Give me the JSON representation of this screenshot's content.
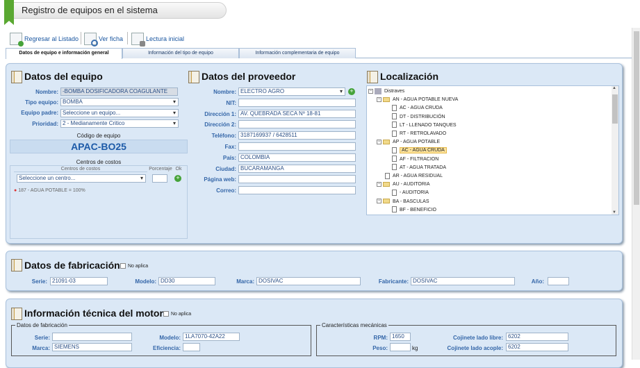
{
  "header": {
    "title": "Registro de equipos en el sistema"
  },
  "toolbar": {
    "back": "Regresar al Listado",
    "view": "Ver ficha",
    "reading": "Lectura inicial"
  },
  "tabs": [
    "Datos de equipo e información general",
    "Información del tipo de equipo",
    "Información complementaria de equipo"
  ],
  "equipo": {
    "title": "Datos del equipo",
    "nombre_label": "Nombre:",
    "nombre": "-BOMBA DOSIFICADORA COAGULANTE",
    "tipo_label": "Tipo equipo:",
    "tipo": "BOMBA",
    "padre_label": "Equipo padre:",
    "padre": "Seleccione un equipo...",
    "prioridad_label": "Prioridad:",
    "prioridad": "2 - Medianamente Critico",
    "codigo_label": "Código de equipo",
    "codigo": "APAC-BO25",
    "centros_title": "Centros de costos",
    "centros_col": "Centros de costos",
    "porcentaje_col": "Porcentaje",
    "ok_col": "Ok",
    "centro_select": "Seleccione un centro...",
    "centro_item": "187 - AGUA POTABLE = 100%"
  },
  "proveedor": {
    "title": "Datos del proveedor",
    "fields": [
      {
        "label": "Nombre:",
        "value": "ELECTRO AGRO"
      },
      {
        "label": "NIT:",
        "value": ""
      },
      {
        "label": "Dirección 1:",
        "value": "AV. QUEBRADA SECA Nº 18-81"
      },
      {
        "label": "Dirección 2:",
        "value": ""
      },
      {
        "label": "Teléfono:",
        "value": "3187169937 / 6428511"
      },
      {
        "label": "Fax:",
        "value": ""
      },
      {
        "label": "País:",
        "value": "COLOMBIA"
      },
      {
        "label": "Ciudad:",
        "value": "BUCARAMANGA"
      },
      {
        "label": "Página web:",
        "value": ""
      },
      {
        "label": "Correo:",
        "value": ""
      }
    ]
  },
  "localizacion": {
    "title": "Localización",
    "tree": [
      {
        "text": "Distraves",
        "type": "root"
      },
      {
        "text": "AN - AGUA POTABLE NUEVA",
        "type": "folder"
      },
      {
        "text": "AC - AGUA CRUDA",
        "type": "doc"
      },
      {
        "text": "DT - DISTRIBUCIÓN",
        "type": "doc"
      },
      {
        "text": "LT - LLENADO TANQUES",
        "type": "doc"
      },
      {
        "text": "RT - RETROLAVADO",
        "type": "doc"
      },
      {
        "text": "AP - AGUA POTABLE",
        "type": "folder"
      },
      {
        "text": "AC - AGUA CRUDA",
        "type": "selected"
      },
      {
        "text": "AF - FILTRACION",
        "type": "doc"
      },
      {
        "text": "AT - AGUA TRATADA",
        "type": "doc"
      },
      {
        "text": "AR - AGUA RESIDUAL",
        "type": "doc1"
      },
      {
        "text": "AU - AUDITORIA",
        "type": "folder"
      },
      {
        "text": "- AUDITORIA",
        "type": "doc"
      },
      {
        "text": "BA - BASCULAS",
        "type": "folder"
      },
      {
        "text": "BF - BENEFICIO",
        "type": "doc"
      }
    ]
  },
  "fabricacion": {
    "title": "Datos de fabricación",
    "no_aplica": "No aplica",
    "serie_label": "Serie:",
    "serie": "21091-03",
    "modelo_label": "Modelo:",
    "modelo": "DD30",
    "marca_label": "Marca:",
    "marca": "DOSIVAC",
    "fabricante_label": "Fabricante:",
    "fabricante": "DOSIVAC",
    "anio_label": "Año:",
    "anio": ""
  },
  "motor": {
    "title": "Información técnica del motor",
    "no_aplica": "No aplica",
    "fab_legend": "Datos de fabricación",
    "serie_label": "Serie:",
    "serie": "",
    "modelo_label": "Modelo:",
    "modelo": "1LA7070-42A22",
    "marca_label": "Marca:",
    "marca": "SIEMENS",
    "eficiencia_label": "Eficiencia:",
    "eficiencia": "",
    "mec_legend": "Características mecánicas",
    "rpm_label": "RPM:",
    "rpm": "1650",
    "peso_label": "Peso:",
    "peso": "",
    "peso_unit": "kg",
    "cojl_label": "Cojinete lado libre:",
    "cojl": "6202",
    "coja_label": "Cojinete lado acople:",
    "coja": "6202"
  }
}
